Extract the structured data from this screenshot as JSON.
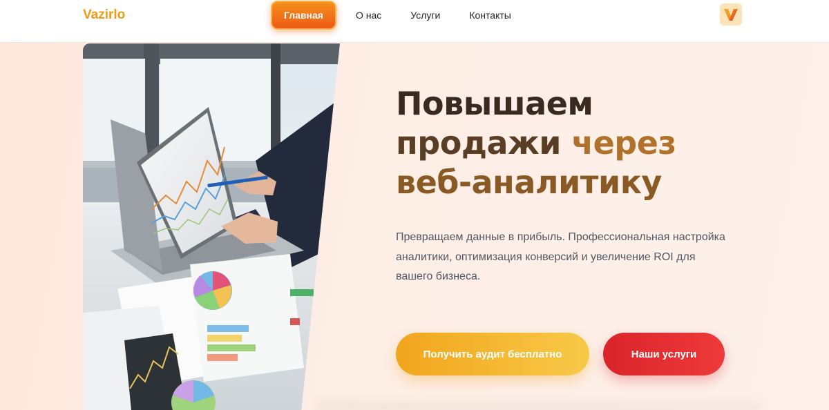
{
  "header": {
    "logo": "Vazirlo",
    "nav": [
      {
        "label": "Главная",
        "active": true
      },
      {
        "label": "О нас",
        "active": false
      },
      {
        "label": "Услуги",
        "active": false
      },
      {
        "label": "Контакты",
        "active": false
      }
    ],
    "brand_icon": "v-logo-icon"
  },
  "hero": {
    "image": "analytics-meeting-photo",
    "title": {
      "line1": "Повышаем",
      "line2a": "продажи",
      "line2b": "через",
      "line3": "веб-аналитику"
    },
    "description": "Превращаем данные в прибыль. Профессиональная настройка аналитики, оптимизация конверсий и увеличение ROI для вашего бизнеса.",
    "buttons": {
      "primary": "Получить аудит бесплатно",
      "secondary": "Наши услуги"
    }
  },
  "colors": {
    "accent": "#f6901a",
    "logo": "#f29a12",
    "primary_button": "#f2a51c",
    "secondary_button": "#d9252a",
    "title_dark": "#3b2a20",
    "title_gold": "#b0722a"
  }
}
